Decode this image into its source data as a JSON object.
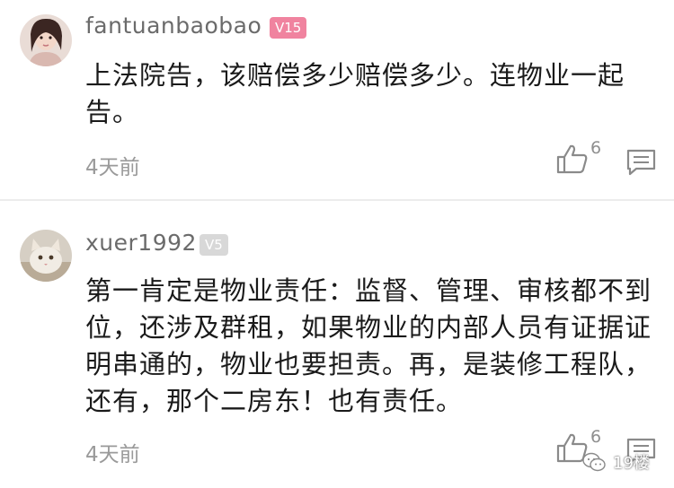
{
  "comments": [
    {
      "username": "fantuanbaobao",
      "level": "V15",
      "text": "上法院告，该赔偿多少赔偿多少。连物业一起告。",
      "time": "4天前",
      "likes": "6"
    },
    {
      "username": "xuer1992",
      "level": "V5",
      "text": "第一肯定是物业责任：监督、管理、审核都不到位，还涉及群租，如果物业的内部人员有证据证明串通的，物业也要担责。再，是装修工程队，还有，那个二房东！也有责任。",
      "time": "4天前",
      "likes": "6"
    }
  ],
  "watermark": "19楼",
  "colors": {
    "badge_high": "#f0839f",
    "badge_low": "#d8d8d8",
    "username": "#6b6b6b",
    "meta": "#9a9a9a"
  }
}
